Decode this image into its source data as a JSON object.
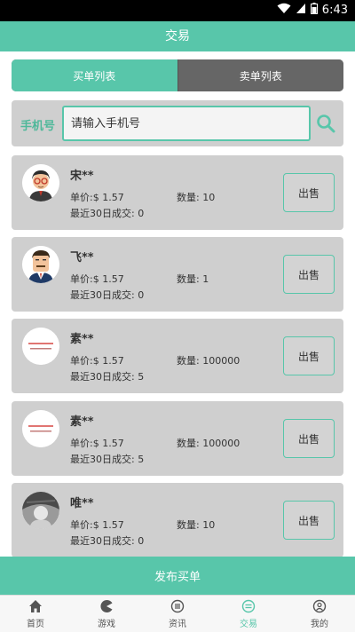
{
  "status_bar": {
    "time": "6:43"
  },
  "title": "交易",
  "tabs": [
    {
      "label": "买单列表",
      "active": true
    },
    {
      "label": "卖单列表",
      "active": false
    }
  ],
  "search": {
    "label": "手机号",
    "placeholder": "请输入手机号"
  },
  "orders": [
    {
      "name": "宋**",
      "price": "单价:$ 1.57",
      "quantity": "数量: 10",
      "recent": "最近30日成交: 0",
      "button": "出售",
      "avatar": "cartoon-man-glasses"
    },
    {
      "name": "飞**",
      "price": "单价:$ 1.57",
      "quantity": "数量: 1",
      "recent": "最近30日成交: 0",
      "button": "出售",
      "avatar": "cartoon-man-suit"
    },
    {
      "name": "素**",
      "price": "单价:$ 1.57",
      "quantity": "数量: 100000",
      "recent": "最近30日成交: 5",
      "button": "出售",
      "avatar": "text-logo"
    },
    {
      "name": "素**",
      "price": "单价:$ 1.57",
      "quantity": "数量: 100000",
      "recent": "最近30日成交: 5",
      "button": "出售",
      "avatar": "text-logo"
    },
    {
      "name": "唯**",
      "price": "单价:$ 1.57",
      "quantity": "数量: 10",
      "recent": "最近30日成交: 0",
      "button": "出售",
      "avatar": "photo"
    }
  ],
  "publish_label": "发布买单",
  "nav": [
    {
      "label": "首页",
      "icon": "home-icon",
      "active": false
    },
    {
      "label": "游戏",
      "icon": "game-icon",
      "active": false
    },
    {
      "label": "资讯",
      "icon": "news-icon",
      "active": false
    },
    {
      "label": "交易",
      "icon": "trade-icon",
      "active": true
    },
    {
      "label": "我的",
      "icon": "profile-icon",
      "active": false
    }
  ],
  "colors": {
    "accent": "#58c6aa",
    "card": "#cfcfcf",
    "tab_inactive": "#666666"
  }
}
